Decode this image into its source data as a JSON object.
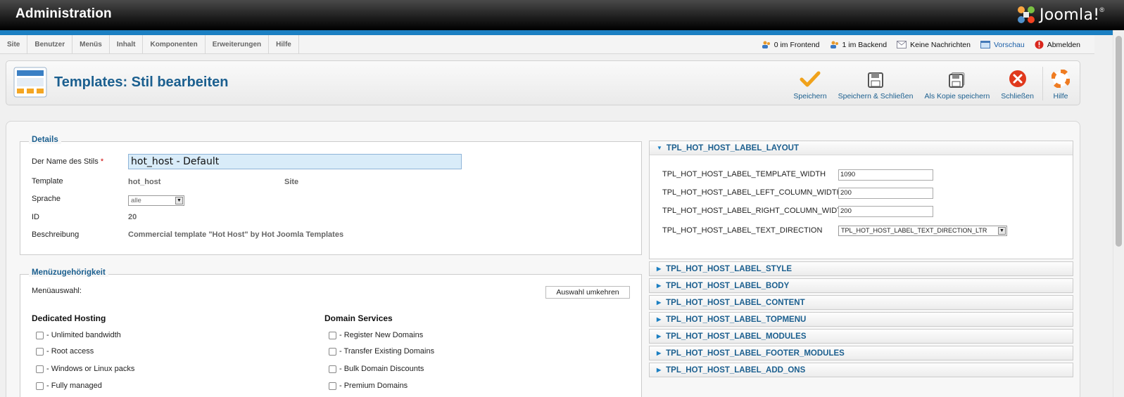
{
  "header": {
    "title": "Administration",
    "logo_text": "Joomla!"
  },
  "menu": {
    "items": [
      "Site",
      "Benutzer",
      "Menüs",
      "Inhalt",
      "Komponenten",
      "Erweiterungen",
      "Hilfe"
    ]
  },
  "status": {
    "frontend": "0 im Frontend",
    "backend": "1 im Backend",
    "messages": "Keine Nachrichten",
    "preview": "Vorschau",
    "logout": "Abmelden"
  },
  "toolbar": {
    "title": "Templates: Stil bearbeiten",
    "save": "Speichern",
    "save_close": "Speichern & Schließen",
    "save_copy": "Als Kopie speichern",
    "close": "Schließen",
    "help": "Hilfe"
  },
  "details": {
    "legend": "Details",
    "name_label": "Der Name des Stils",
    "name_required": "*",
    "name_value": "hot_host - Default",
    "template_label": "Template",
    "template_value": "hot_host",
    "client_value": "Site",
    "language_label": "Sprache",
    "language_value": "alle",
    "id_label": "ID",
    "id_value": "20",
    "description_label": "Beschreibung",
    "description_value": "Commercial template \"Hot Host\" by Hot Joomla Templates"
  },
  "menu_assignment": {
    "legend": "Menüzugehörigkeit",
    "label": "Menüauswahl:",
    "toggle_button": "Auswahl umkehren",
    "columns": [
      {
        "title": "Dedicated Hosting",
        "items": [
          "- Unlimited bandwidth",
          "- Root access",
          "- Windows or Linux packs",
          "- Fully managed"
        ]
      },
      {
        "title": "Domain Services",
        "items": [
          "- Register New Domains",
          "- Transfer Existing Domains",
          "- Bulk Domain Discounts",
          "- Premium Domains"
        ]
      }
    ]
  },
  "params": {
    "layout_title": "TPL_HOT_HOST_LABEL_LAYOUT",
    "fields": [
      {
        "label": "TPL_HOT_HOST_LABEL_TEMPLATE_WIDTH",
        "value": "1090"
      },
      {
        "label": "TPL_HOT_HOST_LABEL_LEFT_COLUMN_WIDTH",
        "value": "200"
      },
      {
        "label": "TPL_HOT_HOST_LABEL_RIGHT_COLUMN_WIDTH",
        "value": "200"
      }
    ],
    "direction_label": "TPL_HOT_HOST_LABEL_TEXT_DIRECTION",
    "direction_value": "TPL_HOT_HOST_LABEL_TEXT_DIRECTION_LTR",
    "sections": [
      "TPL_HOT_HOST_LABEL_STYLE",
      "TPL_HOT_HOST_LABEL_BODY",
      "TPL_HOT_HOST_LABEL_CONTENT",
      "TPL_HOT_HOST_LABEL_TOPMENU",
      "TPL_HOT_HOST_LABEL_MODULES",
      "TPL_HOT_HOST_LABEL_FOOTER_MODULES",
      "TPL_HOT_HOST_LABEL_ADD_ONS"
    ]
  }
}
